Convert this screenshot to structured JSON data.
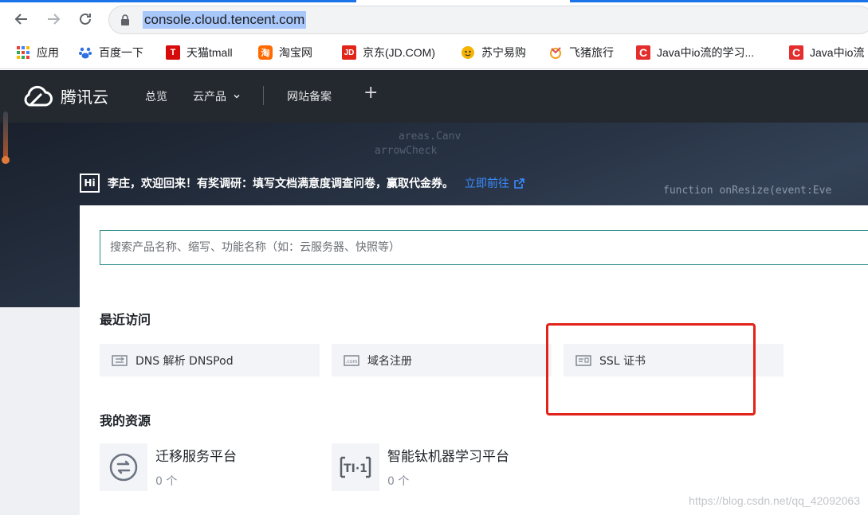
{
  "browser": {
    "url": "console.cloud.tencent.com",
    "bookmarks": [
      {
        "label": "应用",
        "icon": "apps-grid-icon"
      },
      {
        "label": "百度一下",
        "icon": "baidu-paw-icon"
      },
      {
        "label": "天猫tmall",
        "icon": "tmall-icon"
      },
      {
        "label": "淘宝网",
        "icon": "taobao-icon"
      },
      {
        "label": "京东(JD.COM)",
        "icon": "jd-icon"
      },
      {
        "label": "苏宁易购",
        "icon": "suning-icon"
      },
      {
        "label": "飞猪旅行",
        "icon": "fliggy-icon"
      },
      {
        "label": "Java中io流的学习...",
        "icon": "csdn-icon"
      },
      {
        "label": "Java中io流",
        "icon": "csdn-icon"
      }
    ]
  },
  "topnav": {
    "logo_text": "腾讯云",
    "overview": "总览",
    "products": "云产品",
    "filing": "网站备案",
    "plus": "+"
  },
  "hero": {
    "badge": "Hi",
    "welcome": "李庄，欢迎回来！有奖调研：填写文档满意度调查问卷，赢取代金券。",
    "link": "立即前往",
    "code_lines": [
      "arrowCheck",
      "areas.Canv",
      "function onResize(event:Eve"
    ]
  },
  "search": {
    "placeholder": "搜索产品名称、缩写、功能名称（如：云服务器、快照等）"
  },
  "recent": {
    "title": "最近访问",
    "items": [
      {
        "label": "DNS 解析 DNSPod",
        "icon": "dns-icon"
      },
      {
        "label": "域名注册",
        "icon": "domain-com-icon"
      },
      {
        "label": "SSL 证书",
        "icon": "ssl-certificate-icon"
      }
    ]
  },
  "resources": {
    "title": "我的资源",
    "items": [
      {
        "name": "迁移服务平台",
        "count": "0 个",
        "icon": "migration-icon"
      },
      {
        "name": "智能钛机器学习平台",
        "count": "0 个",
        "icon": "ti-one-icon"
      }
    ]
  },
  "watermark": "https://blog.csdn.net/qq_42092063",
  "colors": {
    "nav_bg": "#24292f",
    "link_blue": "#3b8bff",
    "highlight_red": "#e2231a",
    "search_border": "#2a8c8c"
  }
}
